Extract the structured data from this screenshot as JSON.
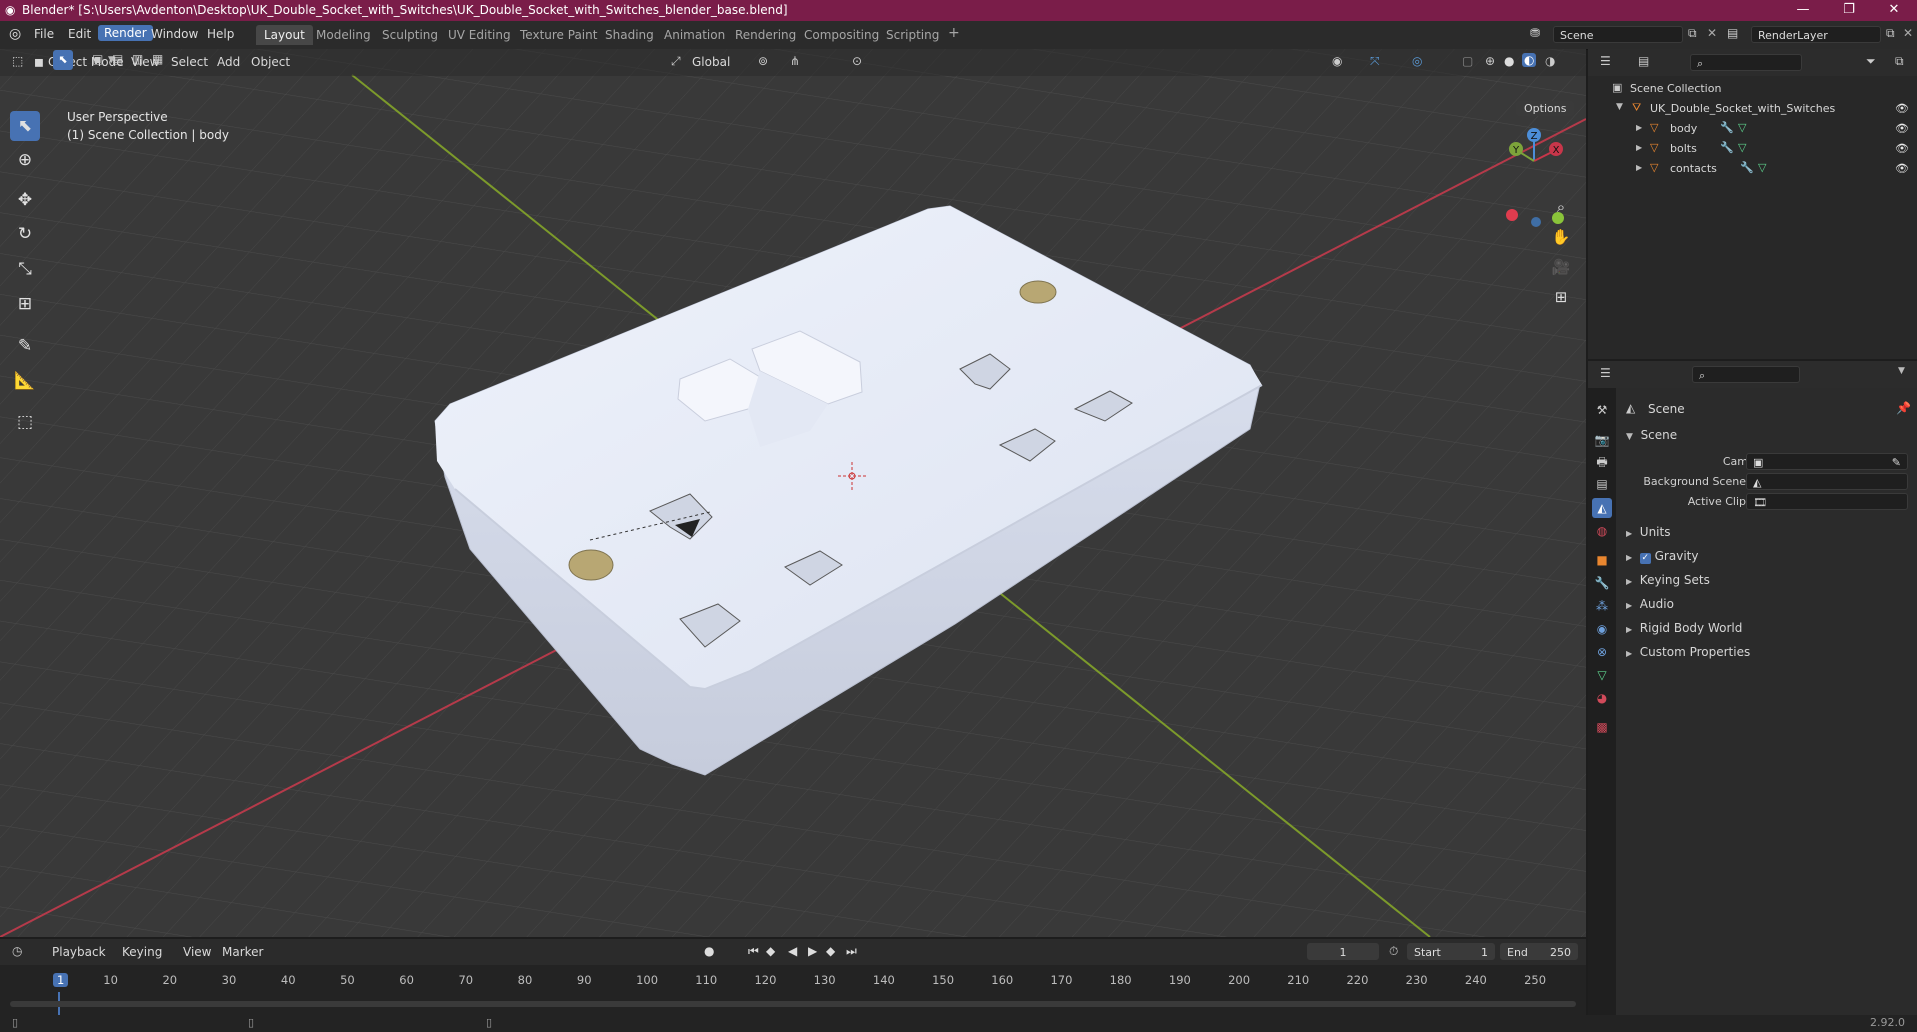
{
  "titlebar": {
    "title": "Blender* [S:\\Users\\Avdenton\\Desktop\\UK_Double_Socket_with_Switches\\UK_Double_Socket_with_Switches_blender_base.blend]",
    "min": "—",
    "max": "❐",
    "close": "✕"
  },
  "topbar": {
    "menus": [
      "File",
      "Edit",
      "Render",
      "Window",
      "Help"
    ],
    "workspaces": [
      "Layout",
      "Modeling",
      "Sculpting",
      "UV Editing",
      "Texture Paint",
      "Shading",
      "Animation",
      "Rendering",
      "Compositing",
      "Scripting"
    ],
    "add_workspace": "+",
    "scene": "Scene",
    "view_layer": "RenderLayer"
  },
  "viewport": {
    "mode": "Object Mode",
    "menus": [
      "View",
      "Select",
      "Add",
      "Object"
    ],
    "orientation": "Global",
    "options": "Options",
    "overlay_line1": "User Perspective",
    "overlay_line2": "(1) Scene Collection | body",
    "gizmo": {
      "x": "X",
      "y": "Y",
      "z": "Z"
    }
  },
  "outliner": {
    "root": "Scene Collection",
    "collection": "UK_Double_Socket_with_Switches",
    "objects": [
      "body",
      "bolts",
      "contacts"
    ]
  },
  "properties": {
    "context": "Scene",
    "panel": "Scene",
    "camera_label": "Camera",
    "bg_scene_label": "Background Scene",
    "active_clip_label": "Active Clip",
    "subpanels": [
      "Units",
      "Gravity",
      "Keying Sets",
      "Audio",
      "Rigid Body World",
      "Custom Properties"
    ]
  },
  "timeline": {
    "menus": [
      "Playback",
      "Keying",
      "View",
      "Marker"
    ],
    "current_frame": "1",
    "start_label": "Start",
    "start": "1",
    "end_label": "End",
    "end": "250",
    "ticks": [
      "1",
      "10",
      "20",
      "30",
      "40",
      "50",
      "60",
      "70",
      "80",
      "90",
      "100",
      "110",
      "120",
      "130",
      "140",
      "150",
      "160",
      "170",
      "180",
      "190",
      "200",
      "210",
      "220",
      "230",
      "240",
      "250"
    ]
  },
  "status": {
    "version": "2.92.0"
  },
  "colors": {
    "accent": "#4772b3",
    "titlebar": "#7a1d49",
    "x_axis": "#b53a4a",
    "y_axis": "#7c9a2b",
    "orange": "#e9862f"
  }
}
